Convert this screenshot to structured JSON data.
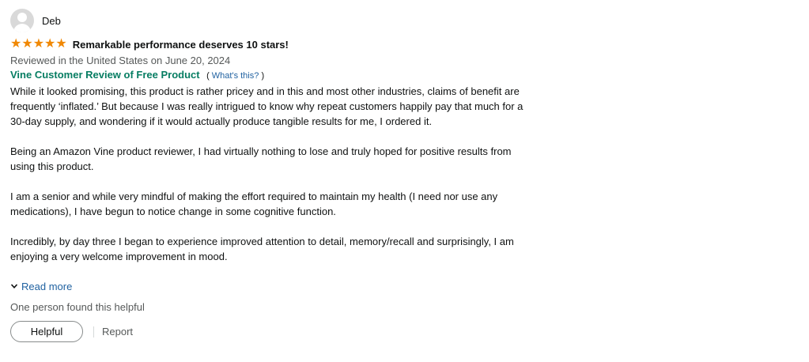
{
  "profile": {
    "name": "Deb",
    "avatar_icon": "default-user-avatar"
  },
  "rating": {
    "stars": 5,
    "max": 5,
    "star_color": "#f08804"
  },
  "review": {
    "title": "Remarkable performance deserves 10 stars!",
    "date_line": "Reviewed in the United States on June 20, 2024",
    "vine_badge": "Vine Customer Review of Free Product",
    "whats_this_open": "(",
    "whats_this_label": "What's this?",
    "whats_this_close": ")",
    "paragraphs": [
      "While it looked promising, this product is rather pricey and in this and most other industries, claims of benefit are frequently ‘inflated.’ But because I was really intrigued to know why repeat customers happily pay that much for a 30-day supply, and wondering if it would actually produce tangible results for me, I ordered it.",
      "Being an Amazon Vine product reviewer, I had virtually nothing to lose and truly hoped for positive results from using this product.",
      "I am a senior and while very mindful of making the effort required to maintain my health (I need nor use any medications), I have begun to notice change in some cognitive function.",
      "Incredibly, by day three I began to experience improved attention to detail, memory/recall and surprisingly, I am enjoying a very welcome improvement in mood."
    ],
    "read_more_label": "Read more",
    "helpful_count_text": "One person found this helpful",
    "helpful_button_label": "Helpful",
    "report_label": "Report"
  },
  "colors": {
    "vine_green": "#067d62",
    "link_blue": "#2162a1",
    "secondary_text": "#565959"
  }
}
